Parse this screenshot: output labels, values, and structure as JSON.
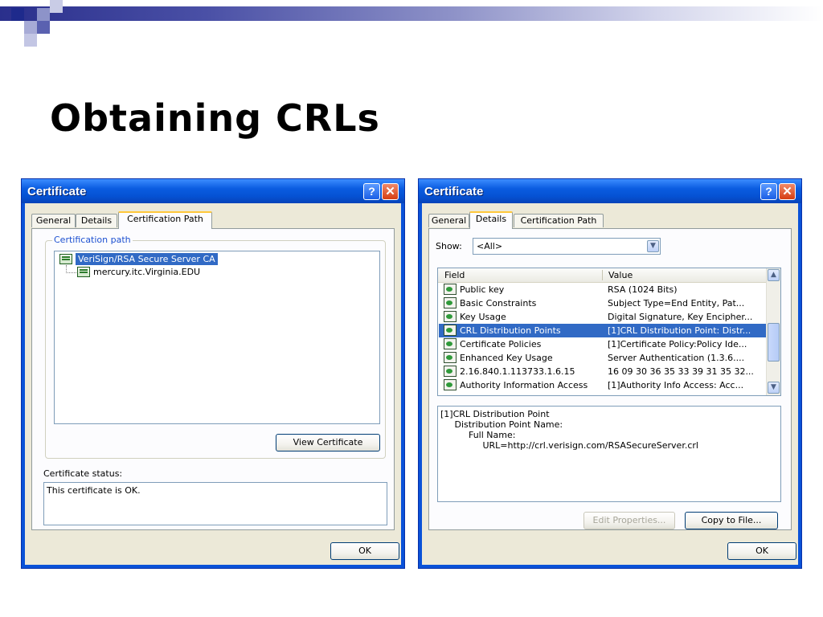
{
  "slide": {
    "title": "Obtaining CRLs"
  },
  "left_dialog": {
    "title": "Certificate",
    "help_glyph": "?",
    "close_glyph": "✕",
    "tabs": [
      {
        "label": "General"
      },
      {
        "label": "Details"
      },
      {
        "label": "Certification Path"
      }
    ],
    "active_tab": "Certification Path",
    "path_group_label": "Certification path",
    "path_items": [
      {
        "label": "VeriSign/RSA Secure Server CA",
        "selected": true
      },
      {
        "label": "mercury.itc.Virginia.EDU",
        "selected": false
      }
    ],
    "view_certificate_label": "View Certificate",
    "status_label": "Certificate status:",
    "status_text": "This certificate is OK.",
    "ok_label": "OK"
  },
  "right_dialog": {
    "title": "Certificate",
    "help_glyph": "?",
    "close_glyph": "✕",
    "tabs": [
      {
        "label": "General"
      },
      {
        "label": "Details"
      },
      {
        "label": "Certification Path"
      }
    ],
    "active_tab": "Details",
    "show_label": "Show:",
    "show_value": "<All>",
    "columns": {
      "field": "Field",
      "value": "Value"
    },
    "rows": [
      {
        "field": "Public key",
        "value": "RSA (1024 Bits)",
        "selected": false
      },
      {
        "field": "Basic Constraints",
        "value": "Subject Type=End Entity, Pat...",
        "selected": false
      },
      {
        "field": "Key Usage",
        "value": "Digital Signature, Key Encipher...",
        "selected": false
      },
      {
        "field": "CRL Distribution Points",
        "value": "[1]CRL Distribution Point: Distr...",
        "selected": true
      },
      {
        "field": "Certificate Policies",
        "value": "[1]Certificate Policy:Policy Ide...",
        "selected": false
      },
      {
        "field": "Enhanced Key Usage",
        "value": "Server Authentication (1.3.6....",
        "selected": false
      },
      {
        "field": "2.16.840.1.113733.1.6.15",
        "value": "16 09 30 36 35 33 39 31 35 32...",
        "selected": false
      },
      {
        "field": "Authority Information Access",
        "value": "[1]Authority Info Access: Acc...",
        "selected": false
      }
    ],
    "detail_lines": [
      "[1]CRL Distribution Point",
      "     Distribution Point Name:",
      "          Full Name:",
      "               URL=http://crl.verisign.com/RSASecureServer.crl"
    ],
    "edit_properties_label": "Edit Properties...",
    "copy_to_file_label": "Copy to File...",
    "ok_label": "OK"
  },
  "colors": {
    "xp_title_blue": "#0552d4",
    "dialog_face": "#ece9d8",
    "selection_blue": "#316ac5",
    "group_label_blue": "#1c50d0",
    "tab_highlight": "#ffc83c"
  }
}
